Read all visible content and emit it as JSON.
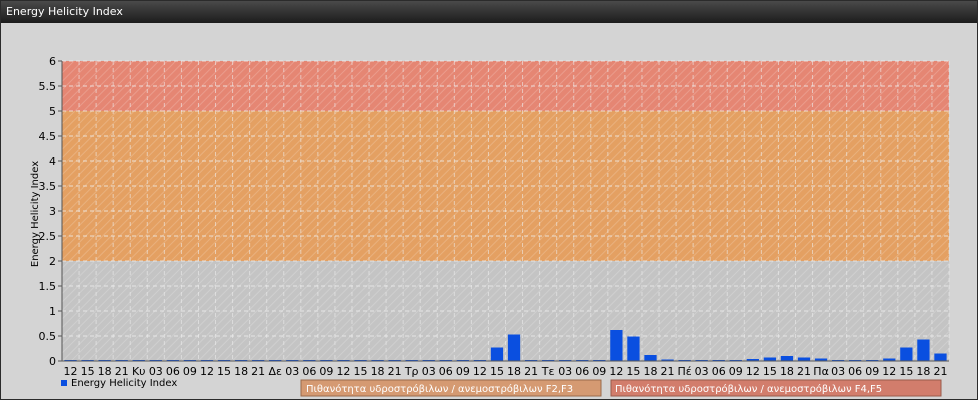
{
  "window": {
    "title": "Energy Helicity Index"
  },
  "colors": {
    "background": "#d4d4d4",
    "plot_bg": "#c8c8c8",
    "band_low": "#c4c4c4",
    "band_mid": "#e4a062",
    "band_high": "#e58673",
    "bar": "#0a4fe0",
    "legend_f23_bg": "#d59a72",
    "legend_f45_bg": "#d27d6c",
    "grid": "#efefef"
  },
  "legend": {
    "series_label": "Energy Helicity Index",
    "f23_label": "Πιθανότητα υδροστρόβιλων / ανεμοστρόβιλων F2,F3",
    "f45_label": "Πιθανότητα υδροστρόβιλων / ανεμοστρόβιλων F4,F5"
  },
  "chart_data": {
    "type": "bar",
    "title": "",
    "ylabel": "Energy Helicity Index",
    "xlabel": "",
    "ylim": [
      0,
      6
    ],
    "yticks": [
      "0",
      "0.5",
      "1",
      "1.5",
      "2",
      "2.5",
      "3",
      "3.5",
      "4",
      "4.5",
      "5",
      "5.5",
      "6"
    ],
    "categories": [
      "12",
      "15",
      "18",
      "21",
      "Κυ",
      "03",
      "06",
      "09",
      "12",
      "15",
      "18",
      "21",
      "Δε",
      "03",
      "06",
      "09",
      "12",
      "15",
      "18",
      "21",
      "Τρ",
      "03",
      "06",
      "09",
      "12",
      "15",
      "18",
      "21",
      "Τε",
      "03",
      "06",
      "09",
      "12",
      "15",
      "18",
      "21",
      "Πέ",
      "03",
      "06",
      "09",
      "12",
      "15",
      "18",
      "21",
      "Πα",
      "03",
      "06",
      "09",
      "12",
      "15",
      "18",
      "21"
    ],
    "series": [
      {
        "name": "Energy Helicity Index",
        "values": [
          0.02,
          0.02,
          0.02,
          0.02,
          0.02,
          0.02,
          0.02,
          0.02,
          0.02,
          0.02,
          0.02,
          0.02,
          0.02,
          0.02,
          0.02,
          0.02,
          0.02,
          0.02,
          0.02,
          0.02,
          0.02,
          0.02,
          0.02,
          0.02,
          0.02,
          0.27,
          0.53,
          0.02,
          0.02,
          0.02,
          0.02,
          0.02,
          0.62,
          0.49,
          0.12,
          0.03,
          0.02,
          0.02,
          0.02,
          0.02,
          0.04,
          0.07,
          0.1,
          0.07,
          0.05,
          0.02,
          0.02,
          0.02,
          0.05,
          0.27,
          0.43,
          0.15
        ]
      }
    ],
    "bands": [
      {
        "from": 0,
        "to": 2,
        "color": "#c4c4c4"
      },
      {
        "from": 2,
        "to": 5,
        "color": "#e4a062"
      },
      {
        "from": 5,
        "to": 6,
        "color": "#e58673"
      }
    ],
    "grid": true,
    "legend_position": "bottom-left"
  }
}
